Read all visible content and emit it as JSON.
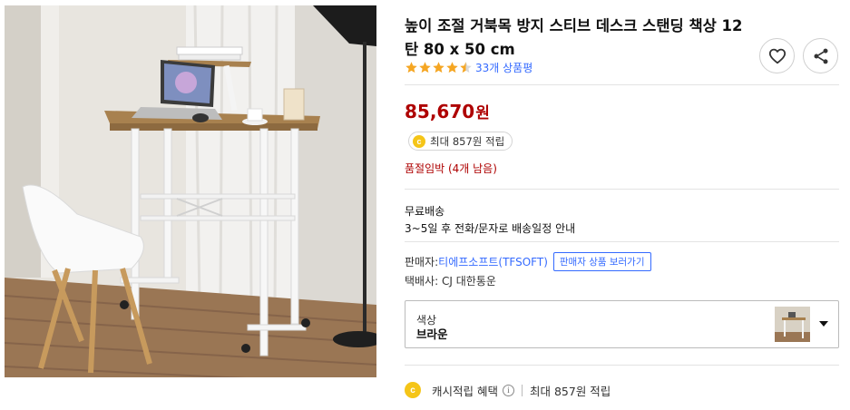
{
  "product": {
    "title": "높이 조절 거북목 방지 스티브 데스크 스탠딩 책상 12탄 80 x 50 cm",
    "rating_value": 4.5,
    "review_count_text": "33개 상품평",
    "price_number": "85,670",
    "price_unit": "원",
    "max_reward_text": "최대 857원 적립",
    "stock_text": "품절임박 (4개 남음)"
  },
  "shipping": {
    "title": "무료배송",
    "description": "3~5일 후 전화/문자로 배송일정 안내"
  },
  "seller": {
    "label": "판매자:",
    "name": "티에프소프트(TFSOFT)",
    "products_button": "판매자 상품 보러가기",
    "courier_label": "택배사:",
    "courier_name": "CJ 대한통운"
  },
  "option": {
    "label": "색상",
    "value": "브라운"
  },
  "cash_reward": {
    "label": "캐시적립 혜택",
    "info_glyph": "i",
    "max_text": "최대 857원 적립"
  },
  "coin_glyph": "c",
  "icons": {
    "wishlist": "heart-icon",
    "share": "share-icon",
    "option_dropdown": "caret-down-icon"
  },
  "colors": {
    "price": "#ae0000",
    "link": "#346aff",
    "star": "#f5a623",
    "coin": "#f5c518"
  }
}
